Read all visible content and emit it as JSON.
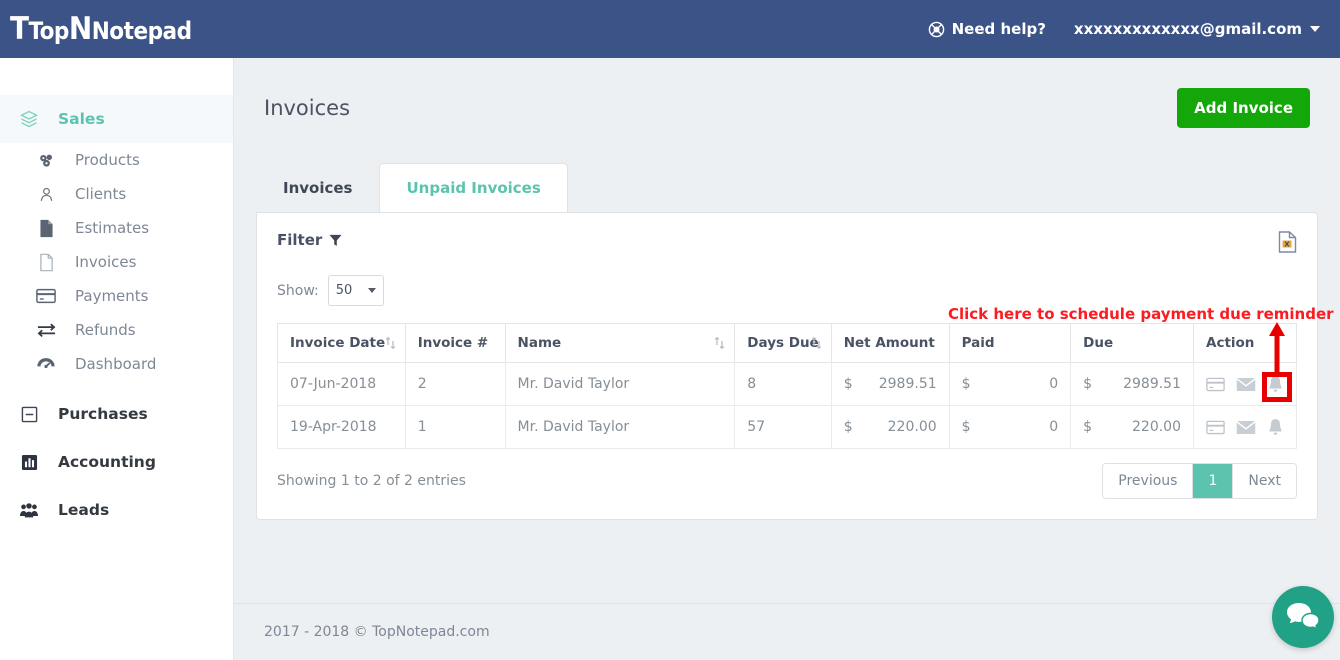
{
  "topbar": {
    "logo_top": "Top",
    "logo_note": "Notepad",
    "help_label": "Need help?",
    "help_icon": "lifebuoy-icon",
    "user_email": "xxxxxxxxxxxxx@gmail.com",
    "caret_icon": "caret-down-icon",
    "bg_color": "#3b5387"
  },
  "sidebar": {
    "groups": [
      {
        "label": "Sales",
        "icon": "layers-icon",
        "active": true
      },
      {
        "label": "Purchases",
        "icon": "minus-square-icon",
        "active": false
      },
      {
        "label": "Accounting",
        "icon": "chart-bar-icon",
        "active": false
      },
      {
        "label": "Leads",
        "icon": "users-icon",
        "active": false
      }
    ],
    "sales_items": [
      {
        "label": "Products",
        "icon": "cubes-icon"
      },
      {
        "label": "Clients",
        "icon": "user-circle-icon"
      },
      {
        "label": "Estimates",
        "icon": "file-filled-icon"
      },
      {
        "label": "Invoices",
        "icon": "file-outline-icon"
      },
      {
        "label": "Payments",
        "icon": "credit-card-icon"
      },
      {
        "label": "Refunds",
        "icon": "exchange-icon"
      },
      {
        "label": "Dashboard",
        "icon": "speedometer-icon"
      }
    ],
    "active_color": "#5cc4ae"
  },
  "page": {
    "title": "Invoices",
    "add_button": "Add Invoice",
    "add_button_color": "#13a709"
  },
  "tabs": [
    {
      "label": "Invoices",
      "active": false
    },
    {
      "label": "Unpaid Invoices",
      "active": true
    }
  ],
  "panel": {
    "filter_label": "Filter",
    "filter_icon": "funnel-icon",
    "export_icon": "excel-export-icon",
    "show_label": "Show:",
    "show_value": "50"
  },
  "table": {
    "headers": [
      {
        "label": "Invoice Date",
        "sortable": true
      },
      {
        "label": "Invoice #",
        "sortable": false
      },
      {
        "label": "Name",
        "sortable": true
      },
      {
        "label": "Days Due",
        "sortable": true
      },
      {
        "label": "Net Amount",
        "sortable": false
      },
      {
        "label": "Paid",
        "sortable": false
      },
      {
        "label": "Due",
        "sortable": false
      },
      {
        "label": "Action",
        "sortable": false
      }
    ],
    "currency": "$",
    "rows": [
      {
        "invoice_date": "07-Jun-2018",
        "invoice_no": "2",
        "name": "Mr. David Taylor",
        "days_due": "8",
        "net_amount": "2989.51",
        "paid": "0",
        "due": "2989.51",
        "actions": [
          "credit-card-icon",
          "envelope-icon",
          "bell-icon"
        ],
        "highlight_action": "bell-icon"
      },
      {
        "invoice_date": "19-Apr-2018",
        "invoice_no": "1",
        "name": "Mr. David Taylor",
        "days_due": "57",
        "net_amount": "220.00",
        "paid": "0",
        "due": "220.00",
        "actions": [
          "credit-card-icon",
          "envelope-icon",
          "bell-icon"
        ],
        "highlight_action": ""
      }
    ],
    "info": "Showing 1 to 2 of 2 entries",
    "pagination": {
      "previous": "Previous",
      "pages": [
        "1"
      ],
      "next": "Next",
      "active_page": "1",
      "active_color": "#5cc4ae"
    }
  },
  "annotation": {
    "text": "Click here to schedule payment due reminder",
    "color": "#fb1b20",
    "arrow_icon": "up-arrow-icon",
    "highlight_box_color": "#e80000"
  },
  "footer": {
    "text": "2017 - 2018 © TopNotepad.com"
  },
  "chat": {
    "icon": "chat-bubbles-icon",
    "color": "#21a186"
  }
}
